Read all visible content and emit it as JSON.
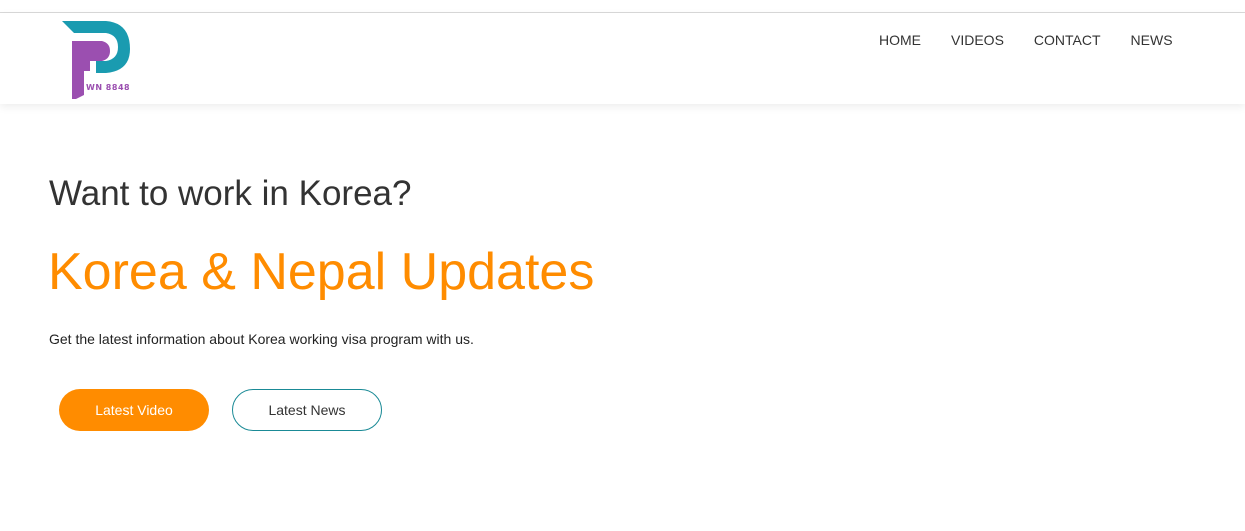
{
  "brand": {
    "logo_text": "WN 8848",
    "logo_colors": {
      "teal": "#1a9bb0",
      "purple": "#9b4fb0"
    }
  },
  "nav": {
    "items": [
      {
        "label": "HOME"
      },
      {
        "label": "VIDEOS"
      },
      {
        "label": "CONTACT"
      },
      {
        "label": "NEWS"
      }
    ]
  },
  "hero": {
    "subtitle": "Want to work in Korea?",
    "title": "Korea & Nepal Updates",
    "description": "Get the latest information about Korea working visa program with us.",
    "primary_button": "Latest Video",
    "secondary_button": "Latest News"
  },
  "colors": {
    "accent": "#ff8c00",
    "outline": "#1a8a96",
    "text": "#333333"
  }
}
